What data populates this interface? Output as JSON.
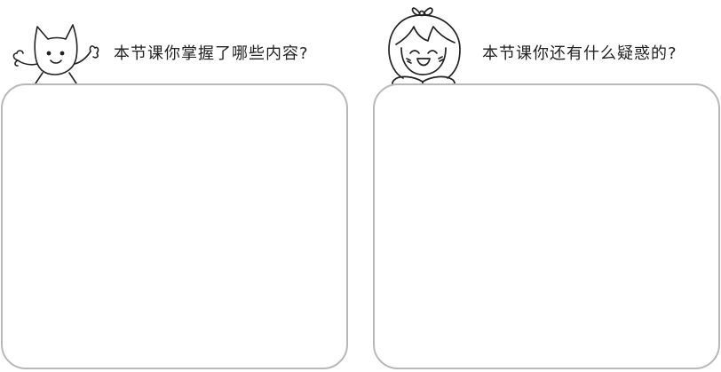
{
  "left_panel": {
    "prompt": "本节课你掌握了哪些内容?",
    "illustration": "cartoon-cat"
  },
  "right_panel": {
    "prompt": "本节课你还有什么疑惑的?",
    "illustration": "cartoon-girl"
  },
  "colors": {
    "border": "#b8b8b8",
    "text": "#222222",
    "line_art": "#222222"
  }
}
